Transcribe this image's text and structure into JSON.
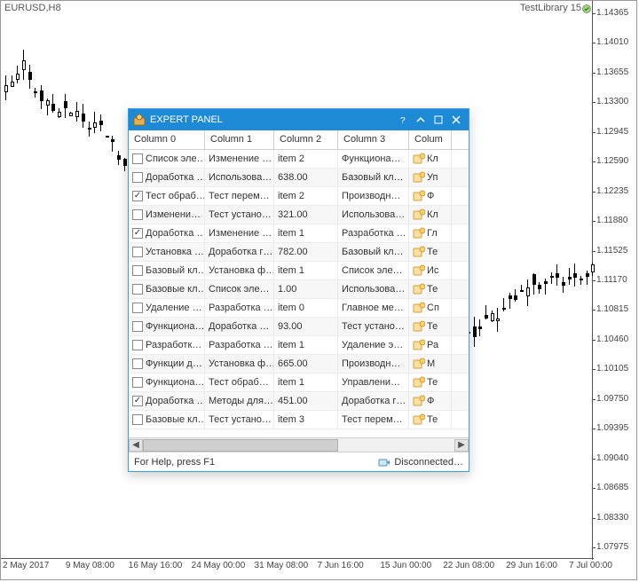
{
  "chart": {
    "symbol_tf": "EURUSD,H8",
    "badge": "TestLibrary 15",
    "y_ticks": [
      "1.14365",
      "1.14010",
      "1.13655",
      "1.13300",
      "1.12945",
      "1.12590",
      "1.12235",
      "1.11880",
      "1.11525",
      "1.11170",
      "1.10815",
      "1.10460",
      "1.10105",
      "1.09750",
      "1.09395",
      "1.09040",
      "1.08685",
      "1.08330",
      "1.07975"
    ],
    "x_ticks": [
      "2 May 2017",
      "9 May 08:00",
      "16 May 16:00",
      "24 May 00:00",
      "31 May 08:00",
      "7 Jun 16:00",
      "15 Jun 00:00",
      "22 Jun 08:00",
      "29 Jun 16:00",
      "7 Jul 00:00"
    ]
  },
  "panel": {
    "title": "EXPERT PANEL",
    "headers": [
      "Column 0",
      "Column 1",
      "Column 2",
      "Column 3",
      "Colum"
    ],
    "rows": [
      {
        "chk": false,
        "c0": "Список эле…",
        "c1": "Изменение …",
        "c2": "item 2",
        "c3": "Функциона…",
        "c4": "Кл"
      },
      {
        "chk": false,
        "c0": "Доработка …",
        "c1": "Использова…",
        "c2": "638.00",
        "c3": "Базовый кл…",
        "c4": "Уп"
      },
      {
        "chk": true,
        "c0": "Тест обраб…",
        "c1": "Тест перем…",
        "c2": "item 2",
        "c3": "Производн…",
        "c4": "Ф"
      },
      {
        "chk": false,
        "c0": "Изменени…",
        "c1": "Тест устано…",
        "c2": "321.00",
        "c3": "Использова…",
        "c4": "Кл"
      },
      {
        "chk": true,
        "c0": "Доработка …",
        "c1": "Изменение …",
        "c2": "item 1",
        "c3": "Разработка …",
        "c4": "Гл"
      },
      {
        "chk": false,
        "c0": "Установка …",
        "c1": "Доработка г…",
        "c2": "782.00",
        "c3": "Базовый кл…",
        "c4": "Те"
      },
      {
        "chk": false,
        "c0": "Базовый кл…",
        "c1": "Установка ф…",
        "c2": "item 1",
        "c3": "Список эле…",
        "c4": "Ис"
      },
      {
        "chk": false,
        "c0": "Базовые кл…",
        "c1": "Список эле…",
        "c2": "1.00",
        "c3": "Использова…",
        "c4": "Те"
      },
      {
        "chk": false,
        "c0": "Удаление …",
        "c1": "Разработка …",
        "c2": "item 0",
        "c3": "Главное ме…",
        "c4": "Сп"
      },
      {
        "chk": false,
        "c0": "Функциона…",
        "c1": "Доработка …",
        "c2": "93.00",
        "c3": "Тест устано…",
        "c4": "Те"
      },
      {
        "chk": false,
        "c0": "Разработк…",
        "c1": "Разработка …",
        "c2": "item 1",
        "c3": "Удаление э…",
        "c4": "Ра"
      },
      {
        "chk": false,
        "c0": "Функции д…",
        "c1": "Установка ф…",
        "c2": "665.00",
        "c3": "Производн…",
        "c4": "М"
      },
      {
        "chk": false,
        "c0": "Функциона…",
        "c1": "Тест обраб…",
        "c2": "item 1",
        "c3": "Управлени…",
        "c4": "Те"
      },
      {
        "chk": true,
        "c0": "Доработка …",
        "c1": "Методы для…",
        "c2": "451.00",
        "c3": "Доработка г…",
        "c4": "Ф"
      },
      {
        "chk": false,
        "c0": "Базовые кл…",
        "c1": "Тест устано…",
        "c2": "item 3",
        "c3": "Тест перем…",
        "c4": "Те"
      }
    ],
    "status_help": "For Help, press F1",
    "status_conn": "Disconnected…"
  }
}
